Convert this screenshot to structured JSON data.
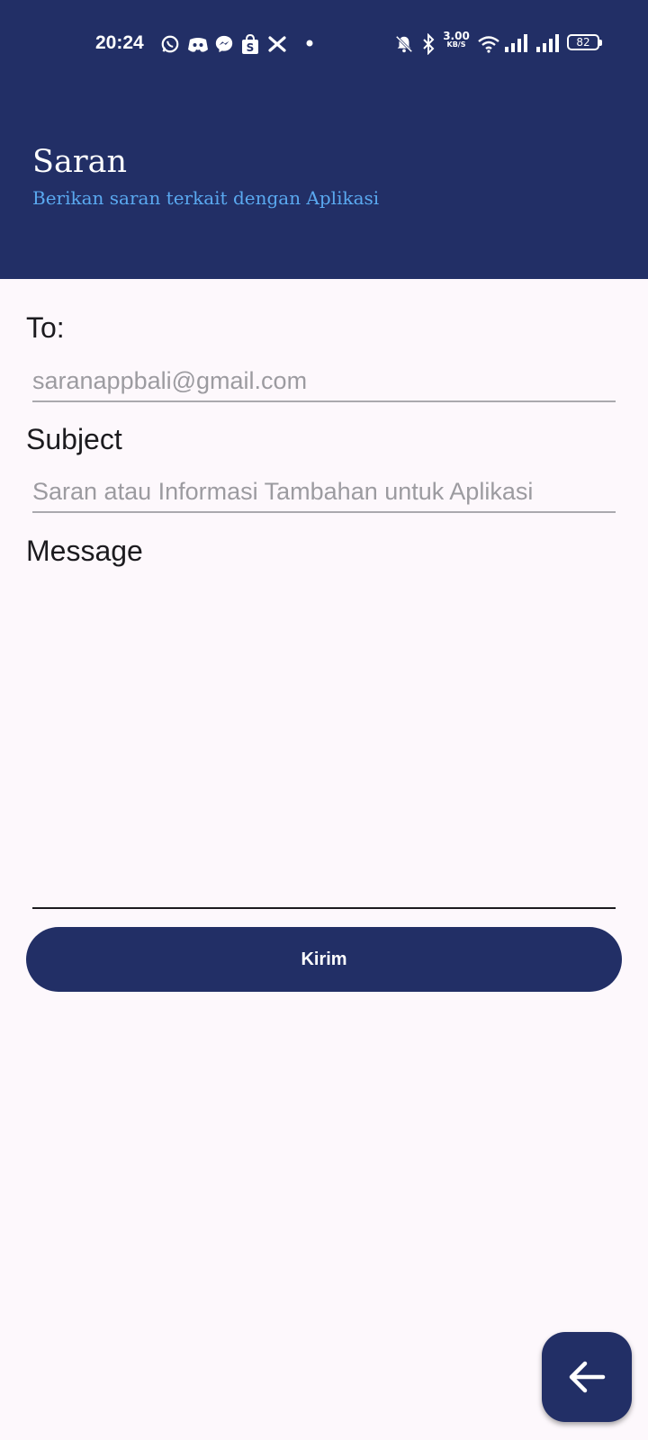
{
  "status_bar": {
    "time": "20:24",
    "net_speed_value": "3.00",
    "net_speed_unit": "KB/S",
    "battery": "82",
    "icons_left": [
      "whatsapp-icon",
      "discord-icon",
      "messenger-icon",
      "shopee-icon",
      "x-icon",
      "dot-icon"
    ],
    "icons_right": [
      "bell-off-icon",
      "bluetooth-icon",
      "wifi-icon",
      "signal-icon",
      "signal-icon",
      "battery-icon"
    ]
  },
  "header": {
    "title": "Saran",
    "subtitle": "Berikan saran terkait dengan Aplikasi",
    "background": "#222f66",
    "subtitle_color": "#5aa9f0"
  },
  "form": {
    "to_label": "To:",
    "to_value": "saranappbali@gmail.com",
    "subject_label": "Subject",
    "subject_value": "Saran atau Informasi Tambahan untuk Aplikasi",
    "message_label": "Message",
    "message_value": "",
    "send_label": "Kirim"
  },
  "fab": {
    "icon": "arrow-left-icon"
  }
}
